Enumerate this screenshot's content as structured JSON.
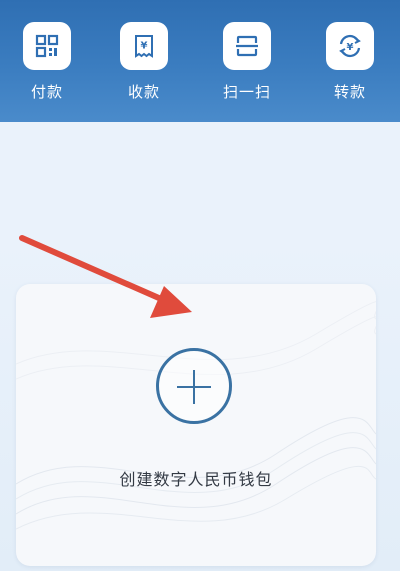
{
  "header": {
    "actions": [
      {
        "label": "付款",
        "icon": "qr-code-icon"
      },
      {
        "label": "收款",
        "icon": "yuan-receipt-icon"
      },
      {
        "label": "扫一扫",
        "icon": "scan-icon"
      },
      {
        "label": "转款",
        "icon": "yuan-exchange-icon"
      }
    ]
  },
  "wallet_card": {
    "create_label": "创建数字人民币钱包",
    "icon": "plus-circle-icon"
  },
  "annotation": {
    "icon": "red-arrow-icon",
    "color": "#e04b3c"
  },
  "colors": {
    "header": "#3b7dc0",
    "accent": "#3a72a3"
  }
}
